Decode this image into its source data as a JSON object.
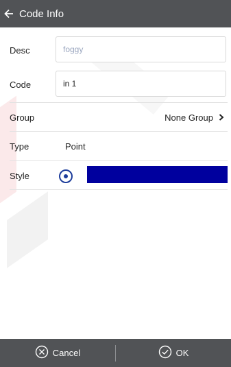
{
  "header": {
    "title": "Code Info",
    "back_icon": "arrow-left-icon"
  },
  "form": {
    "desc": {
      "label": "Desc",
      "placeholder": "foggy",
      "value": ""
    },
    "code": {
      "label": "Code",
      "value": "in 1"
    },
    "group": {
      "label": "Group",
      "value": "None Group",
      "icon": "chevron-right-icon"
    },
    "type": {
      "label": "Type",
      "value": "Point"
    },
    "style": {
      "label": "Style",
      "selected": true,
      "color": "#00009e"
    }
  },
  "footer": {
    "cancel_label": "Cancel",
    "ok_label": "OK",
    "cancel_icon": "circle-x-icon",
    "ok_icon": "circle-check-icon"
  },
  "colors": {
    "bar": "#515356",
    "accent": "#1d3d9b"
  }
}
